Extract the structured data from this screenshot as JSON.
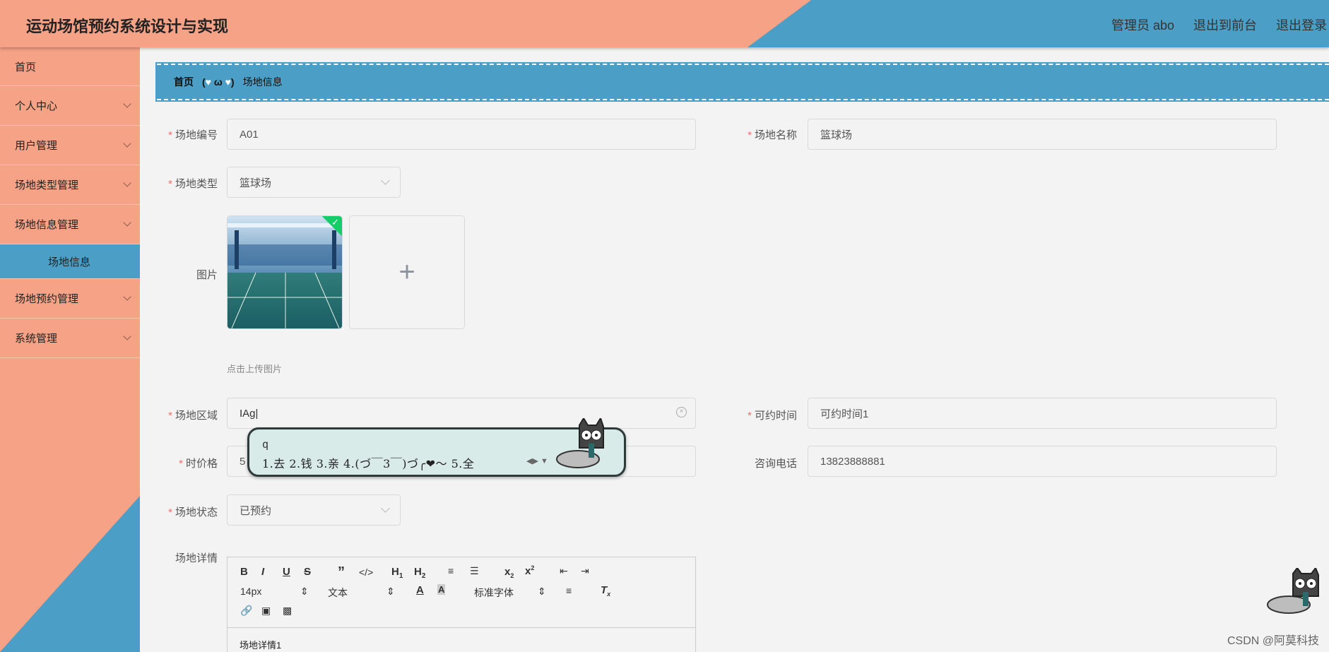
{
  "header": {
    "title": "运动场馆预约系统设计与实现",
    "links": [
      "管理员 abo",
      "退出到前台",
      "退出登录"
    ]
  },
  "sidebar": {
    "items": [
      {
        "label": "首页"
      },
      {
        "label": "个人中心"
      },
      {
        "label": "用户管理"
      },
      {
        "label": "场地类型管理"
      },
      {
        "label": "场地信息管理"
      },
      {
        "label": "场地信息"
      },
      {
        "label": "场地预约管理"
      },
      {
        "label": "系统管理"
      }
    ]
  },
  "breadcrumb": {
    "home": "首页",
    "separator": "(💙 ω 💙)",
    "current": "场地信息"
  },
  "form": {
    "venue_no_label": "场地编号",
    "venue_no_value": "A01",
    "venue_name_label": "场地名称",
    "venue_name_value": "篮球场",
    "venue_type_label": "场地类型",
    "venue_type_value": "篮球场",
    "image_label": "图片",
    "upload_tip": "点击上传图片",
    "area_label": "场地区域",
    "area_value": "Ag",
    "avail_time_label": "可约时间",
    "avail_time_value": "可约时间1",
    "price_label": "时价格",
    "price_value": "5",
    "phone_label": "咨询电话",
    "phone_value": "13823888881",
    "status_label": "场地状态",
    "status_value": "已预约",
    "detail_label": "场地详情"
  },
  "ime": {
    "composition": "q",
    "candidates": "1.去  2.钱  3.亲  4.(づ￣3￣)づ╭❤～  5.全"
  },
  "editor": {
    "font_size": "14px",
    "paragraph": "文本",
    "font_family": "标准字体",
    "content": "场地详情1"
  },
  "watermark": "CSDN @阿莫科技",
  "colors": {
    "salmon": "#f5a286",
    "blue": "#4b9fc6",
    "required": "#f56c6c",
    "success": "#13ce66"
  }
}
